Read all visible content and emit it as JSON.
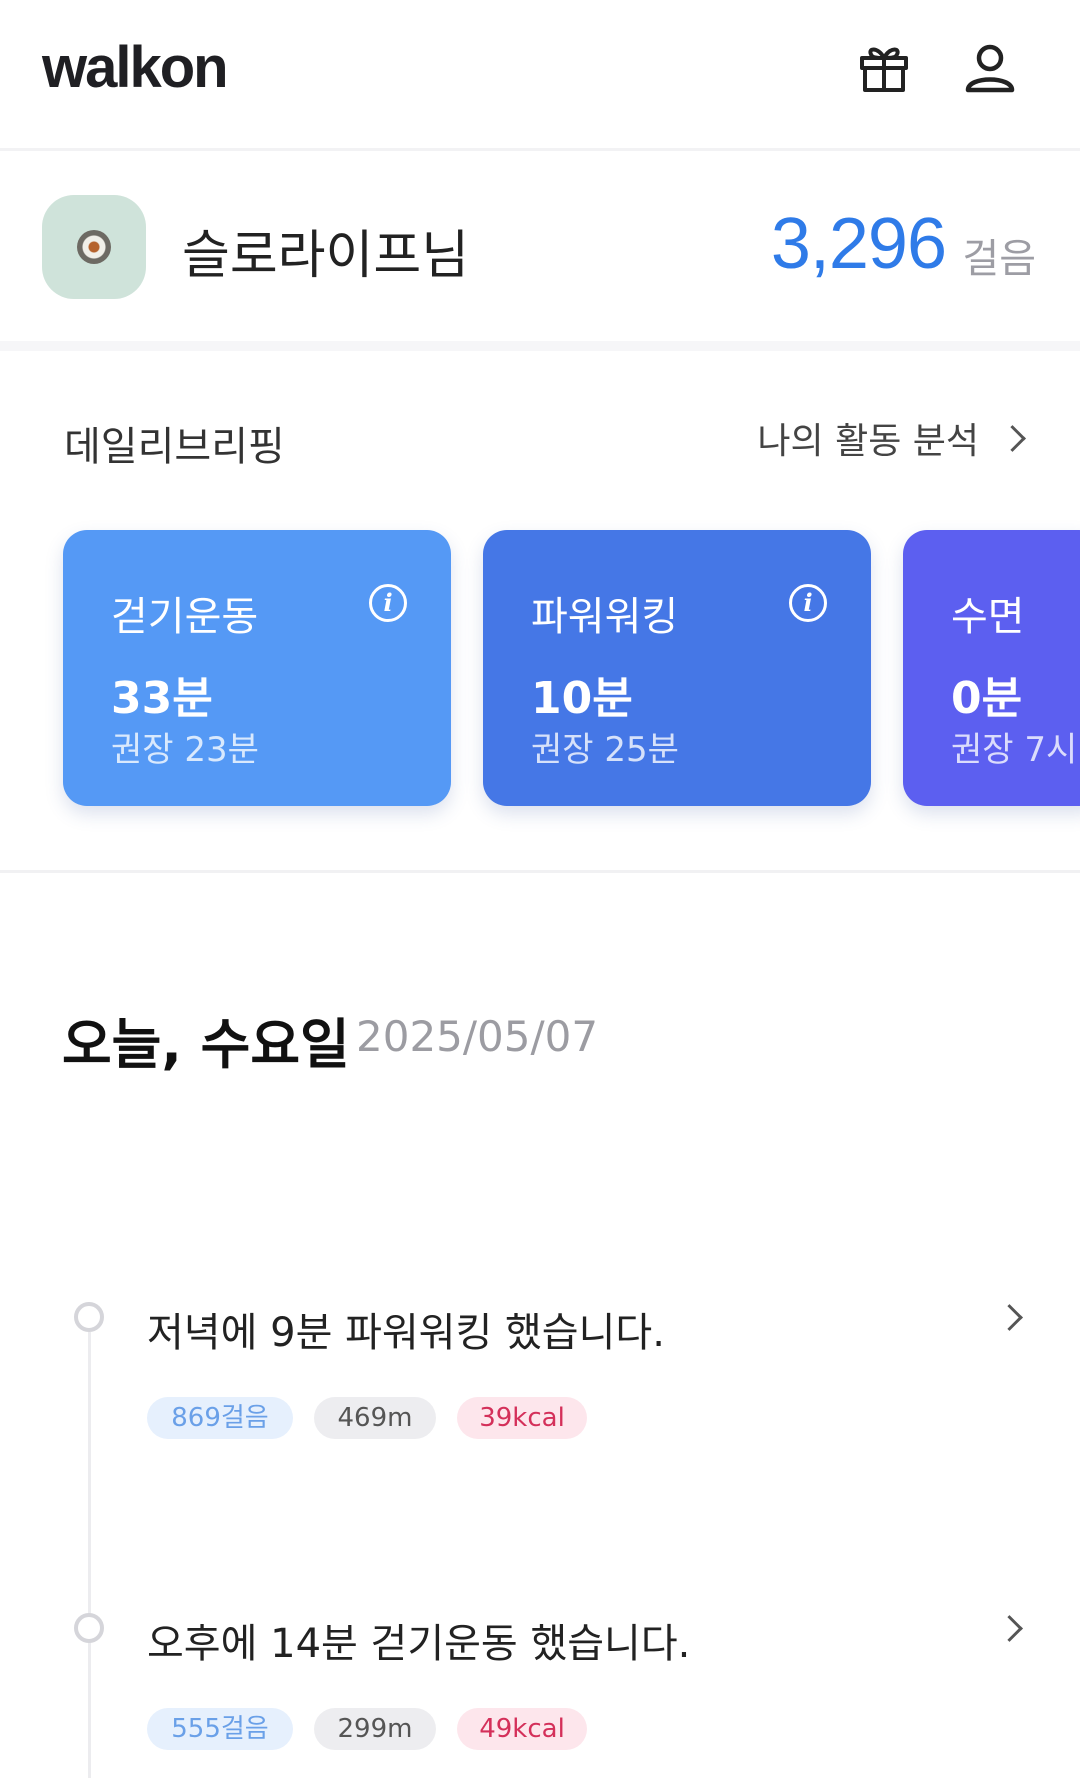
{
  "header": {
    "logo": "walkon",
    "gift_icon": "gift-icon",
    "user_icon": "user-icon"
  },
  "profile": {
    "nickname": "슬로라이프님",
    "steps": "3,296",
    "steps_unit": "걸음"
  },
  "briefing": {
    "title": "데일리브리핑",
    "link_label": "나의 활동 분석",
    "cards": [
      {
        "title": "걷기운동",
        "value": "33분",
        "recommended": "권장 23분",
        "color": "#5599f5"
      },
      {
        "title": "파워워킹",
        "value": "10분",
        "recommended": "권장 25분",
        "color": "#4577e6"
      },
      {
        "title": "수면",
        "value": "0분",
        "recommended": "권장 7시",
        "color": "#5c5ff0"
      }
    ]
  },
  "today": {
    "label": "오늘, 수요일",
    "date": "2025/05/07"
  },
  "activities": [
    {
      "text": "저녁에 9분 파워워킹 했습니다.",
      "steps": "869걸음",
      "distance": "469m",
      "kcal": "39kcal"
    },
    {
      "text": "오후에 14분 걷기운동 했습니다.",
      "steps": "555걸음",
      "distance": "299m",
      "kcal": "49kcal"
    }
  ],
  "colors": {
    "accent": "#2f7be8",
    "steps_chip": "#e6f0fd",
    "kcal_chip": "#fde6ec"
  }
}
